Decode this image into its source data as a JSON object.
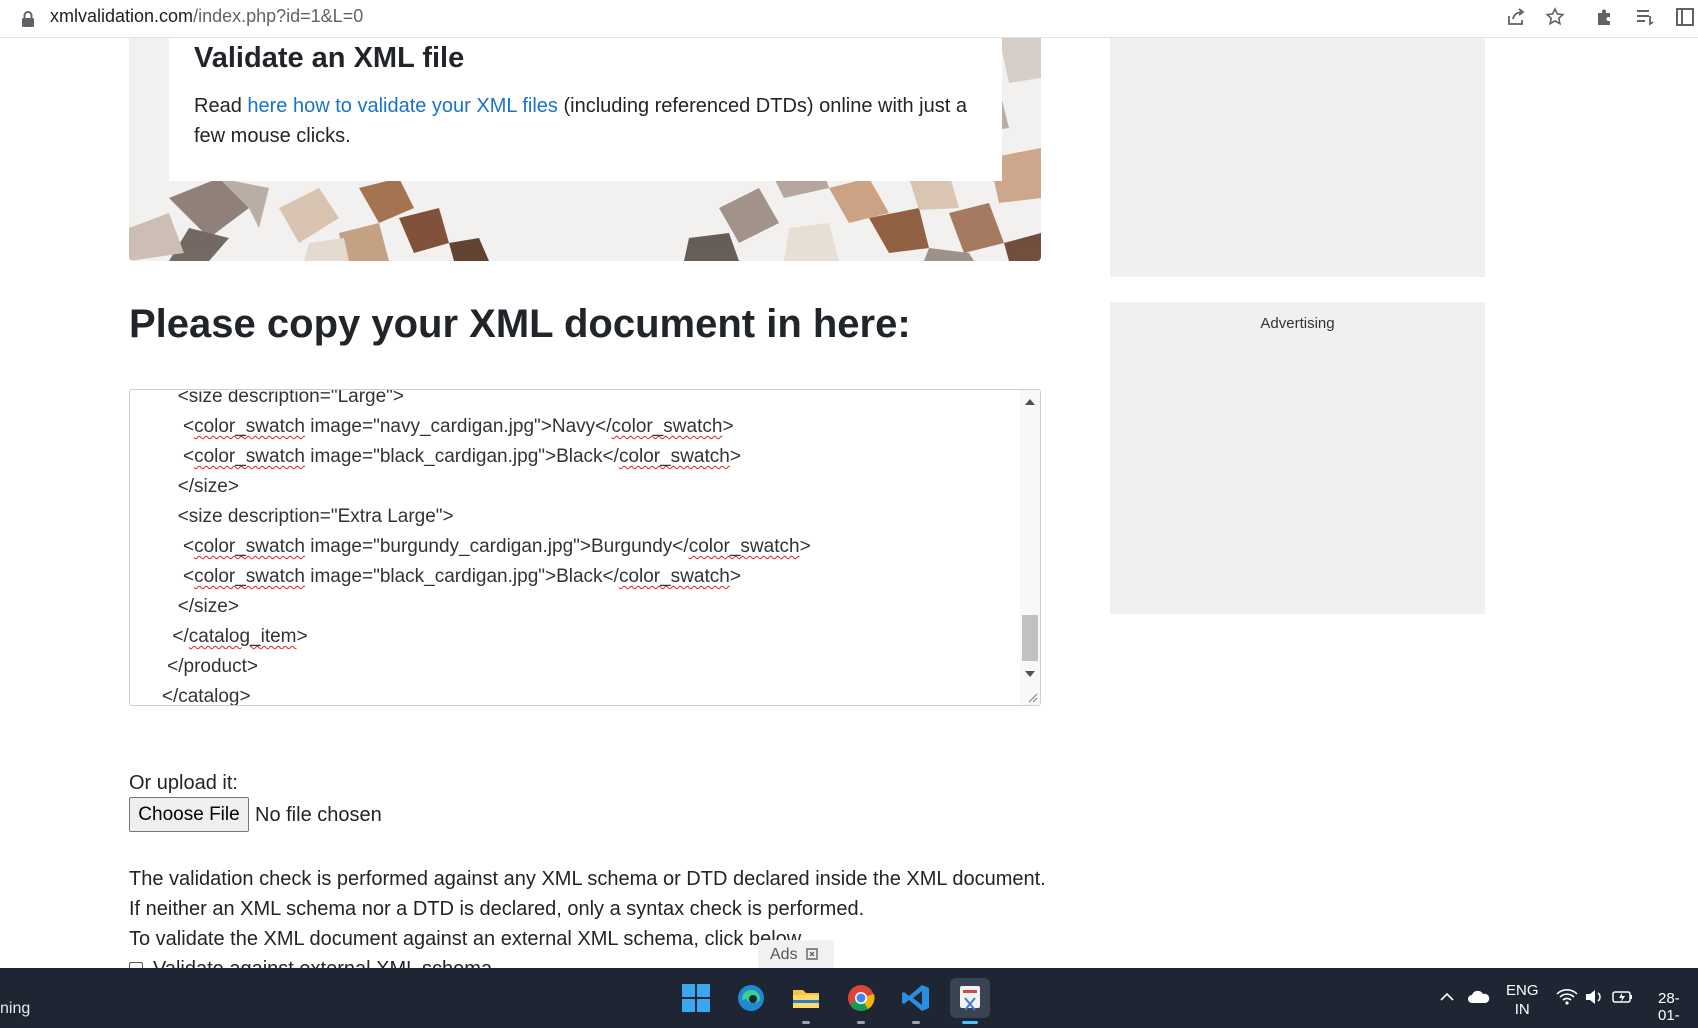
{
  "browser": {
    "url_domain": "xmlvalidation.com",
    "url_path": "/index.php?id=1&L=0"
  },
  "hero": {
    "title": "Validate an XML file",
    "text_before": "Read ",
    "link_text": "here how to validate your XML files",
    "text_after": " (including referenced DTDs) online with just a few mouse clicks."
  },
  "main": {
    "title": "Please copy your XML document in here:"
  },
  "editor": {
    "lines": [
      {
        "indent": "      ",
        "parts": [
          {
            "t": "<size description=\"Large\">"
          }
        ]
      },
      {
        "indent": "       ",
        "parts": [
          {
            "t": "<"
          },
          {
            "t": "color_swatch",
            "sq": true
          },
          {
            "t": " image=\"navy_cardigan.jpg\">Navy</"
          },
          {
            "t": "color_swatch",
            "sq": true
          },
          {
            "t": ">"
          }
        ]
      },
      {
        "indent": "       ",
        "parts": [
          {
            "t": "<"
          },
          {
            "t": "color_swatch",
            "sq": true
          },
          {
            "t": " image=\"black_cardigan.jpg\">Black</"
          },
          {
            "t": "color_swatch",
            "sq": true
          },
          {
            "t": ">"
          }
        ]
      },
      {
        "indent": "      ",
        "parts": [
          {
            "t": "</size>"
          }
        ]
      },
      {
        "indent": "      ",
        "parts": [
          {
            "t": "<size description=\"Extra Large\">"
          }
        ]
      },
      {
        "indent": "       ",
        "parts": [
          {
            "t": "<"
          },
          {
            "t": "color_swatch",
            "sq": true
          },
          {
            "t": " image=\"burgundy_cardigan.jpg\">Burgundy</"
          },
          {
            "t": "color_swatch",
            "sq": true
          },
          {
            "t": ">"
          }
        ]
      },
      {
        "indent": "       ",
        "parts": [
          {
            "t": "<"
          },
          {
            "t": "color_swatch",
            "sq": true
          },
          {
            "t": " image=\"black_cardigan.jpg\">Black</"
          },
          {
            "t": "color_swatch",
            "sq": true
          },
          {
            "t": ">"
          }
        ]
      },
      {
        "indent": "      ",
        "parts": [
          {
            "t": "</size>"
          }
        ]
      },
      {
        "indent": "     ",
        "parts": [
          {
            "t": "</"
          },
          {
            "t": "catalog_item",
            "sq": true
          },
          {
            "t": ">"
          }
        ]
      },
      {
        "indent": "    ",
        "parts": [
          {
            "t": "</product>"
          }
        ]
      },
      {
        "indent": "   ",
        "parts": [
          {
            "t": "</catalog>"
          }
        ]
      }
    ]
  },
  "upload": {
    "label": "Or upload it:",
    "button": "Choose File",
    "status": "No file chosen"
  },
  "description": {
    "line1": "The validation check is performed against any XML schema or DTD declared inside the XML document.",
    "line2": "If neither an XML schema nor a DTD is declared, only a syntax check is performed.",
    "line3": "To validate the XML document against an external XML schema, click below.",
    "checkbox_label": "Validate against external XML schema"
  },
  "ads": {
    "tag": "Ads",
    "advertising_label": "Advertising"
  },
  "taskbar": {
    "left_text": "ning",
    "lang_top": "ENG",
    "lang_bottom": "IN",
    "date": "28-01-"
  }
}
